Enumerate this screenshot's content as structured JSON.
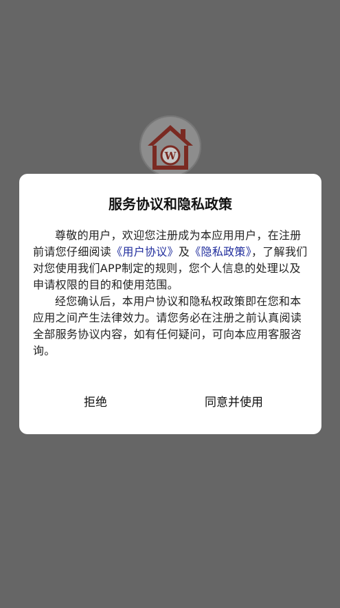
{
  "dialog": {
    "title": "服务协议和隐私政策",
    "paragraph1": {
      "before": "尊敬的用户，欢迎您注册成为本应用用户，在注册前请您仔细阅读",
      "link_user_agreement": "《用户协议》",
      "middle": "及",
      "link_privacy_policy": "《隐私政策》",
      "after": "，了解我们对您使用我们APP制定的规则，您个人信息的处理以及申请权限的目的和使用范围。"
    },
    "paragraph2": "经您确认后，本用户协议和隐私权政策即在您和本应用之间产生法律效力。请您务必在注册之前认真阅读全部服务协议内容，如有任何疑问，可向本应用客服咨询。",
    "reject_label": "拒绝",
    "agree_label": "同意并使用"
  },
  "logo": {
    "icon": "house-logo-icon",
    "text": "W"
  },
  "colors": {
    "scrim": "#666666",
    "dialog_bg": "#ffffff",
    "link": "#1f2c9c",
    "logo_red": "#8b2a20"
  }
}
